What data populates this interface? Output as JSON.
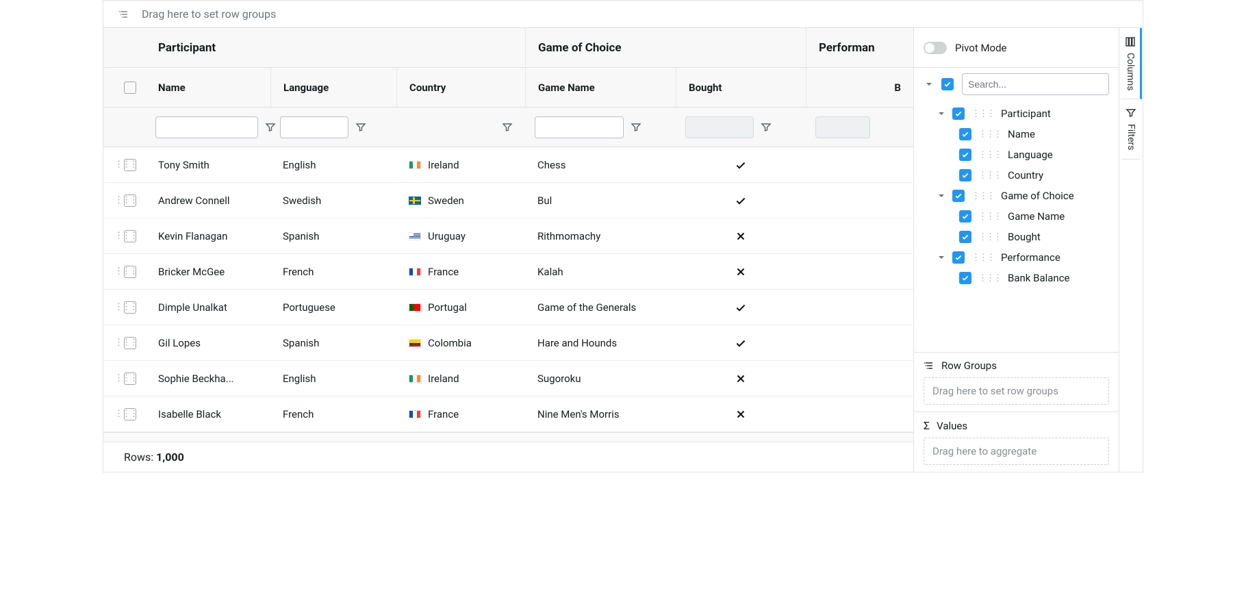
{
  "groupBar": {
    "placeholder": "Drag here to set row groups"
  },
  "header": {
    "groups": {
      "participant": "Participant",
      "game": "Game of Choice",
      "performance": "Performan"
    },
    "cols": {
      "name": "Name",
      "language": "Language",
      "country": "Country",
      "gameName": "Game Name",
      "bought": "Bought",
      "perfExtra": "B"
    }
  },
  "rows": [
    {
      "name": "Tony Smith",
      "language": "English",
      "country": "Ireland",
      "flag": "ie",
      "game": "Chess",
      "bought": true
    },
    {
      "name": "Andrew Connell",
      "language": "Swedish",
      "country": "Sweden",
      "flag": "se",
      "game": "Bul",
      "bought": true
    },
    {
      "name": "Kevin Flanagan",
      "language": "Spanish",
      "country": "Uruguay",
      "flag": "uy",
      "game": "Rithmomachy",
      "bought": false
    },
    {
      "name": "Bricker McGee",
      "language": "French",
      "country": "France",
      "flag": "fr",
      "game": "Kalah",
      "bought": false
    },
    {
      "name": "Dimple Unalkat",
      "language": "Portuguese",
      "country": "Portugal",
      "flag": "pt",
      "game": "Game of the Generals",
      "bought": true
    },
    {
      "name": "Gil Lopes",
      "language": "Spanish",
      "country": "Colombia",
      "flag": "co",
      "game": "Hare and Hounds",
      "bought": true
    },
    {
      "name": "Sophie Beckha...",
      "language": "English",
      "country": "Ireland",
      "flag": "ie",
      "game": "Sugoroku",
      "bought": false
    },
    {
      "name": "Isabelle Black",
      "language": "French",
      "country": "France",
      "flag": "fr",
      "game": "Nine Men's Morris",
      "bought": false
    }
  ],
  "status": {
    "label": "Rows:",
    "value": "1,000"
  },
  "sidepanel": {
    "pivotLabel": "Pivot Mode",
    "searchPlaceholder": "Search...",
    "tree": [
      {
        "label": "Participant",
        "children": [
          {
            "label": "Name"
          },
          {
            "label": "Language"
          },
          {
            "label": "Country"
          }
        ]
      },
      {
        "label": "Game of Choice",
        "children": [
          {
            "label": "Game Name"
          },
          {
            "label": "Bought"
          }
        ]
      },
      {
        "label": "Performance",
        "children": [
          {
            "label": "Bank Balance"
          }
        ]
      }
    ],
    "rowGroupsTitle": "Row Groups",
    "rowGroupsDrop": "Drag here to set row groups",
    "valuesTitle": "Values",
    "valuesDrop": "Drag here to aggregate"
  },
  "sidebuttons": {
    "columns": "Columns",
    "filters": "Filters"
  }
}
